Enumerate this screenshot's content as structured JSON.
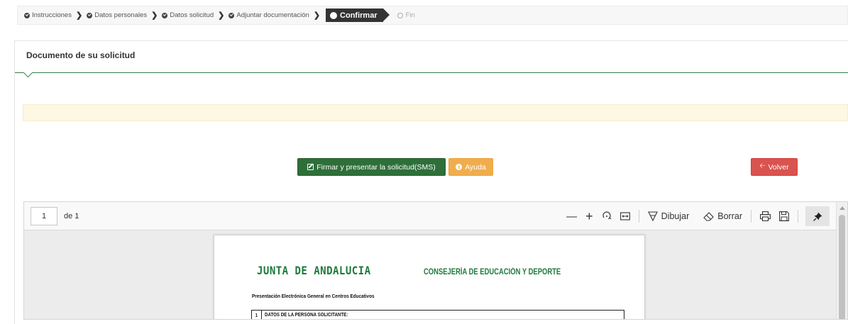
{
  "wizard": {
    "steps": [
      {
        "label": "Instrucciones",
        "state": "done"
      },
      {
        "label": "Datos personales",
        "state": "done"
      },
      {
        "label": "Datos solicitud",
        "state": "done"
      },
      {
        "label": "Adjuntar documentación",
        "state": "done"
      },
      {
        "label": "Confirmar",
        "state": "active"
      },
      {
        "label": "Fin",
        "state": "pending"
      }
    ]
  },
  "panel": {
    "title": "Documento de su solicitud"
  },
  "actions": {
    "sign_label": "Firmar y presentar la solicitud(SMS)",
    "help_label": "Ayuda",
    "back_label": "Volver"
  },
  "colors": {
    "primary_green": "#2e6f39",
    "warning": "#f0ad4e",
    "danger": "#d9534f",
    "brand_green": "#1e7a3c"
  },
  "viewer": {
    "page_current": "1",
    "page_of": "de 1",
    "tools": {
      "zoom_out_icon": "minus-icon",
      "zoom_in_icon": "plus-icon",
      "rotate_icon": "rotate-icon",
      "fit_icon": "fit-width-icon",
      "draw_label": "Dibujar",
      "erase_label": "Borrar",
      "print_icon": "print-icon",
      "save_icon": "save-icon",
      "pin_icon": "pin-icon"
    }
  },
  "document": {
    "brand": "JUNTA DE ANDALUCIA",
    "department": "CONSEJERÍA DE EDUCACIÓN Y DEPORTE",
    "subtitle": "Presentación Electrónica General en Centros Educativos",
    "section_number": "1",
    "section_title": "DATOS DE LA PERSONA SOLICITANTE:"
  }
}
